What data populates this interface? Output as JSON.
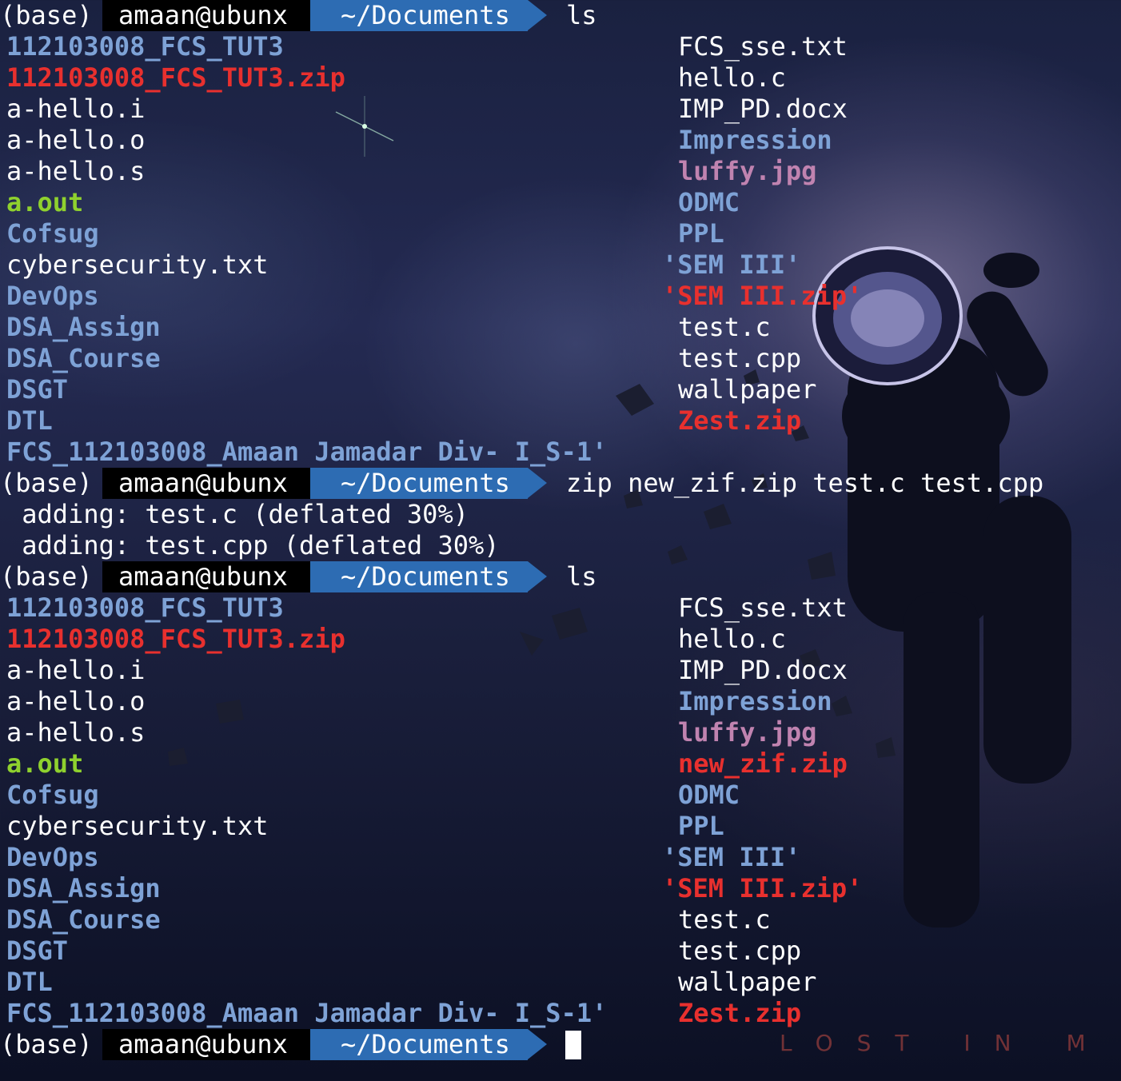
{
  "prompt": {
    "env": "(base)",
    "user_host": "amaan@ubunx",
    "cwd": "~/Documents"
  },
  "blocks": [
    {
      "command": "ls",
      "listing": {
        "left": [
          {
            "name": "112103008_FCS_TUT3",
            "kind": "dir"
          },
          {
            "name": "112103008_FCS_TUT3.zip",
            "kind": "zip"
          },
          {
            "name": "a-hello.i",
            "kind": "plain"
          },
          {
            "name": "a-hello.o",
            "kind": "plain"
          },
          {
            "name": "a-hello.s",
            "kind": "plain"
          },
          {
            "name": "a.out",
            "kind": "exe"
          },
          {
            "name": "Cofsug",
            "kind": "dir"
          },
          {
            "name": "cybersecurity.txt",
            "kind": "plain"
          },
          {
            "name": "DevOps",
            "kind": "dir"
          },
          {
            "name": "DSA_Assign",
            "kind": "dir"
          },
          {
            "name": "DSA_Course",
            "kind": "dir"
          },
          {
            "name": "DSGT",
            "kind": "dir"
          },
          {
            "name": "DTL",
            "kind": "dir"
          },
          {
            "name": "FCS_112103008_Amaan Jamadar Div- I_S-1'",
            "kind": "dir"
          }
        ],
        "right": [
          {
            "name": "FCS_sse.txt",
            "kind": "plain"
          },
          {
            "name": "hello.c",
            "kind": "plain"
          },
          {
            "name": "IMP_PD.docx",
            "kind": "plain"
          },
          {
            "name": "Impression",
            "kind": "dir"
          },
          {
            "name": "luffy.jpg",
            "kind": "img"
          },
          {
            "name": "ODMC",
            "kind": "dir"
          },
          {
            "name": "PPL",
            "kind": "dir"
          },
          {
            "name": "'SEM III'",
            "kind": "quote-dir"
          },
          {
            "name": "'SEM III.zip'",
            "kind": "quote-zip"
          },
          {
            "name": "test.c",
            "kind": "plain"
          },
          {
            "name": "test.cpp",
            "kind": "plain"
          },
          {
            "name": "wallpaper",
            "kind": "plain"
          },
          {
            "name": "Zest.zip",
            "kind": "zip"
          }
        ]
      }
    },
    {
      "command": "zip new_zif.zip test.c test.cpp",
      "output": [
        " adding: test.c (deflated 30%)",
        " adding: test.cpp (deflated 30%)"
      ]
    },
    {
      "command": "ls",
      "listing": {
        "left": [
          {
            "name": "112103008_FCS_TUT3",
            "kind": "dir"
          },
          {
            "name": "112103008_FCS_TUT3.zip",
            "kind": "zip"
          },
          {
            "name": "a-hello.i",
            "kind": "plain"
          },
          {
            "name": "a-hello.o",
            "kind": "plain"
          },
          {
            "name": "a-hello.s",
            "kind": "plain"
          },
          {
            "name": "a.out",
            "kind": "exe"
          },
          {
            "name": "Cofsug",
            "kind": "dir"
          },
          {
            "name": "cybersecurity.txt",
            "kind": "plain"
          },
          {
            "name": "DevOps",
            "kind": "dir"
          },
          {
            "name": "DSA_Assign",
            "kind": "dir"
          },
          {
            "name": "DSA_Course",
            "kind": "dir"
          },
          {
            "name": "DSGT",
            "kind": "dir"
          },
          {
            "name": "DTL",
            "kind": "dir"
          },
          {
            "name": "FCS_112103008_Amaan Jamadar Div- I_S-1'",
            "kind": "dir"
          }
        ],
        "right": [
          {
            "name": "FCS_sse.txt",
            "kind": "plain"
          },
          {
            "name": "hello.c",
            "kind": "plain"
          },
          {
            "name": "IMP_PD.docx",
            "kind": "plain"
          },
          {
            "name": "Impression",
            "kind": "dir"
          },
          {
            "name": "luffy.jpg",
            "kind": "img"
          },
          {
            "name": "new_zif.zip",
            "kind": "zip"
          },
          {
            "name": "ODMC",
            "kind": "dir"
          },
          {
            "name": "PPL",
            "kind": "dir"
          },
          {
            "name": "'SEM III'",
            "kind": "quote-dir"
          },
          {
            "name": "'SEM III.zip'",
            "kind": "quote-zip"
          },
          {
            "name": "test.c",
            "kind": "plain"
          },
          {
            "name": "test.cpp",
            "kind": "plain"
          },
          {
            "name": "wallpaper",
            "kind": "plain"
          },
          {
            "name": "Zest.zip",
            "kind": "zip"
          }
        ]
      }
    },
    {
      "command": "",
      "cursor": true
    }
  ],
  "wallpaper_text": "LOST IN M",
  "colors": {
    "dir": "#7ea2d6",
    "zip": "#e8302e",
    "exe": "#8fd12e",
    "img": "#c083b0",
    "prompt_user_bg": "#000000",
    "prompt_cwd_bg": "#2d6cb3"
  }
}
